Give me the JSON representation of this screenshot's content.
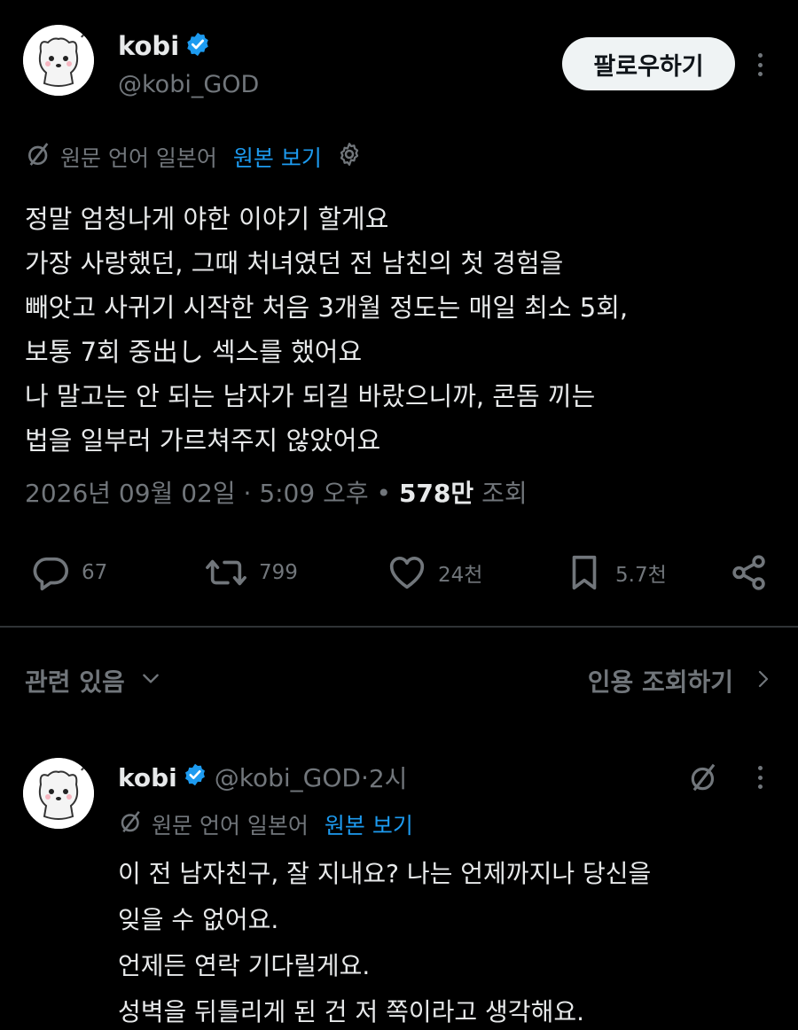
{
  "tweet": {
    "author_name": "kobi",
    "author_handle": "@kobi_GOD",
    "follow_label": "팔로우하기",
    "translate_prefix": "원문 언어 일본어",
    "translate_link": "원본 보기",
    "body_lines": [
      "정말 엄청나게 야한 이야기 할게요",
      "가장 사랑했던, 그때 처녀였던 전 남친의 첫 경험을",
      "빼앗고 사귀기 시작한 처음 3개월 정도는 매일 최소 5회,",
      "보통 7회 중出し 섹스를 했어요",
      "나 말고는 안 되는 남자가 되길 바랐으니까, 콘돔 끼는",
      "법을 일부러 가르쳐주지 않았어요"
    ],
    "date": "2026년 09월 02일",
    "sep1": " · ",
    "time": "5:09 오후",
    "sep2": " • ",
    "views_count": "578만",
    "views_label": " 조회",
    "actions": {
      "replies": "67",
      "retweets": "799",
      "likes": "24천",
      "bookmarks": "5.7천"
    }
  },
  "related": {
    "label": "관련 있음",
    "quotes_label": "인용 조회하기"
  },
  "reply": {
    "author_name": "kobi",
    "author_handle": "@kobi_GOD",
    "time_sep": " · ",
    "time": "2시",
    "translate_prefix": "원문 언어 일본어",
    "translate_link": "원본 보기",
    "body_lines": [
      "이 전 남자친구, 잘 지내요? 나는 언제까지나 당신을",
      "잊을 수 없어요.",
      "언제든 연락 기다릴게요.",
      "성벽을 뒤틀리게 된 건 저 쪽이라고 생각해요."
    ]
  },
  "colors": {
    "background": "#000000",
    "text": "#e7e9ea",
    "muted": "#71767b",
    "link": "#1d9bf0",
    "verified": "#1d9bf0",
    "divider": "#2f3336"
  },
  "icons": [
    "verified-badge-icon",
    "translate-icon",
    "gear-icon",
    "more-icon",
    "reply-icon",
    "retweet-icon",
    "like-icon",
    "bookmark-icon",
    "share-icon",
    "chevron-down-icon",
    "chevron-right-icon"
  ]
}
